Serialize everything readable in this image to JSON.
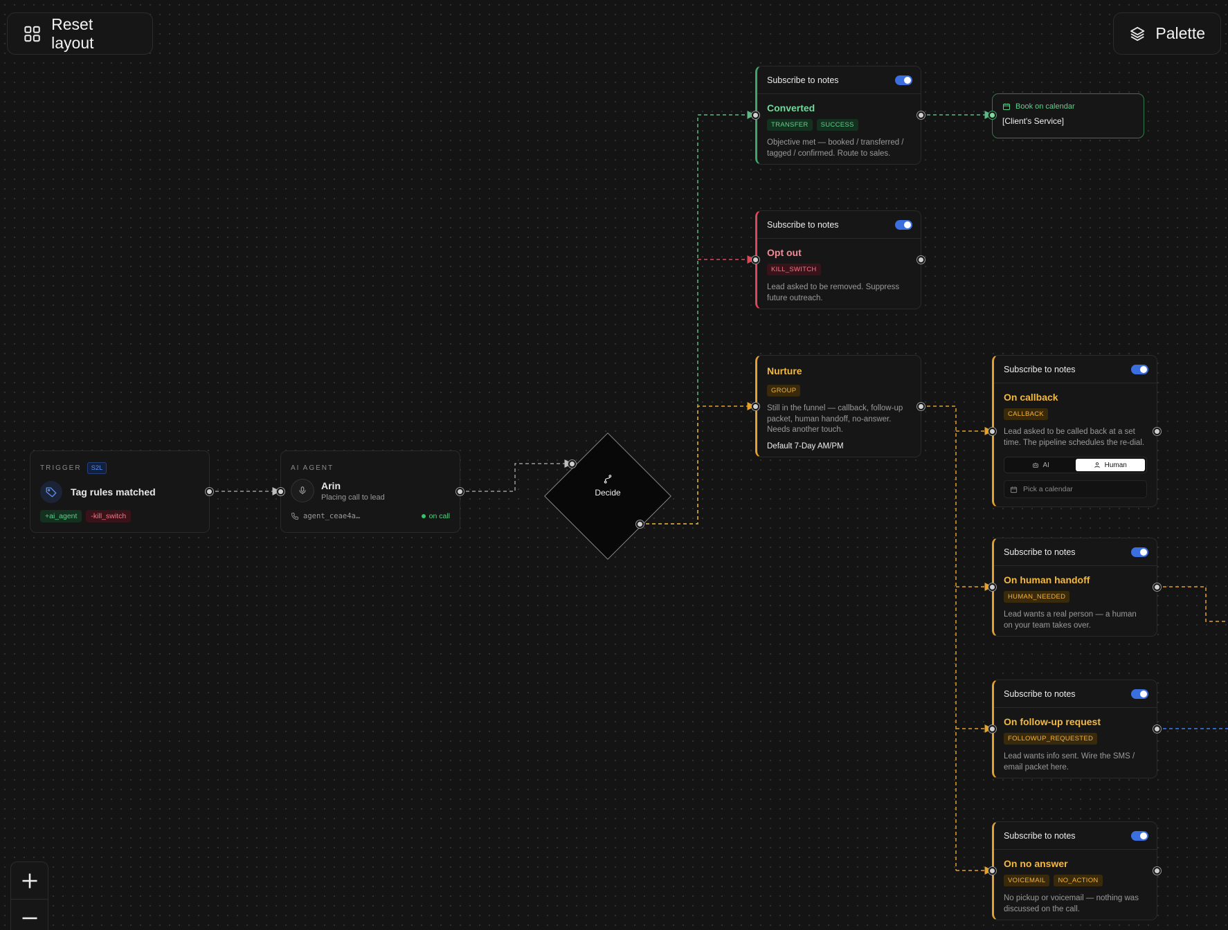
{
  "toolbar": {
    "reset_label": "Reset layout",
    "palette_label": "Palette"
  },
  "zoom": {
    "in_icon": "plus-icon",
    "out_icon": "minus-icon"
  },
  "colors": {
    "green": "#3aa866",
    "red": "#e0485a",
    "amber": "#e5a12b",
    "blue": "#3b6fe0",
    "wire_gray": "#9a9a9a"
  },
  "trigger": {
    "kicker": "TRIGGER",
    "badge": "S2L",
    "title": "Tag rules matched",
    "icon": "tag-icon",
    "tags": [
      {
        "label": "+ai_agent"
      },
      {
        "label": "-kill_switch"
      }
    ]
  },
  "agent": {
    "kicker": "AI AGENT",
    "name": "Arin",
    "status_text": "Placing call to lead",
    "agent_id": "agent_ceae4a…",
    "state": "on call",
    "icon": "microphone-icon"
  },
  "decide": {
    "label": "Decide",
    "icon": "branch-icon"
  },
  "outcomes": {
    "converted": {
      "head": "Subscribe to notes",
      "title": "Converted",
      "badges": [
        "TRANSFER",
        "SUCCESS"
      ],
      "desc": "Objective met — booked / transferred / tagged / confirmed. Route to sales."
    },
    "optout": {
      "head": "Subscribe to notes",
      "title": "Opt out",
      "badges": [
        "KILL_SWITCH"
      ],
      "desc": "Lead asked to be removed. Suppress future outreach."
    },
    "nurture": {
      "title": "Nurture",
      "badges": [
        "GROUP"
      ],
      "desc": "Still in the funnel — callback, follow-up packet, human handoff, no-answer. Needs another touch.",
      "footer": "Default 7-Day AM/PM"
    }
  },
  "calendar_action": {
    "label": "Book on calendar",
    "value": "[Client's Service]",
    "icon": "calendar-icon"
  },
  "nurture_children": {
    "callback": {
      "head": "Subscribe to notes",
      "title": "On callback",
      "badges": [
        "CALLBACK"
      ],
      "desc": "Lead asked to be called back at a set time. The pipeline schedules the re-dial.",
      "seg_ai": "AI",
      "seg_human": "Human",
      "pick_calendar": "Pick a calendar"
    },
    "handoff": {
      "head": "Subscribe to notes",
      "title": "On human handoff",
      "badges": [
        "HUMAN_NEEDED"
      ],
      "desc": "Lead wants a real person — a human on your team takes over."
    },
    "followup": {
      "head": "Subscribe to notes",
      "title": "On follow-up request",
      "badges": [
        "FOLLOWUP_REQUESTED"
      ],
      "desc": "Lead wants info sent. Wire the SMS / email packet here."
    },
    "noanswer": {
      "head": "Subscribe to notes",
      "title": "On no answer",
      "badges": [
        "VOICEMAIL",
        "NO_ACTION"
      ],
      "desc": "No pickup or voicemail — nothing was discussed on the call."
    }
  }
}
